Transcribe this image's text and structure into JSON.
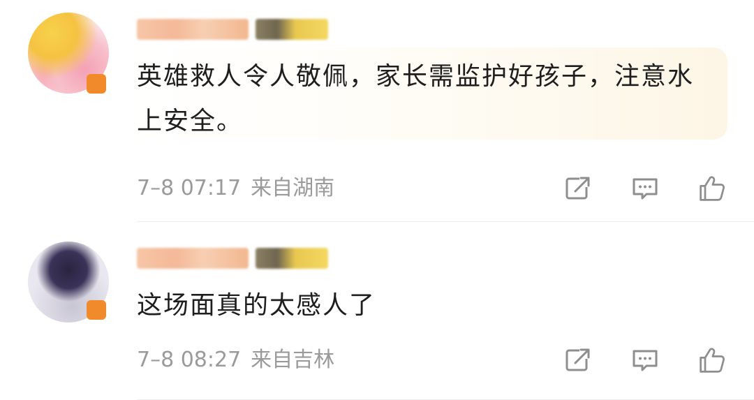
{
  "comments": [
    {
      "text": "英雄救人令人敬佩，家长需监护好孩子，注意水上安全。",
      "date": "7–8 07:17",
      "location": "来自湖南",
      "actions": {
        "share_icon": "share-icon",
        "comment_icon": "comment-icon",
        "like_icon": "like-icon"
      }
    },
    {
      "text": "这场面真的太感人了",
      "date": "7–8 08:27",
      "location": "来自吉林",
      "actions": {
        "share_icon": "share-icon",
        "comment_icon": "comment-icon",
        "like_icon": "like-icon"
      }
    }
  ],
  "colors": {
    "text": "#1e1e1e",
    "meta": "#9a9a9a",
    "icon": "#8e8e8e",
    "divider": "#ececec"
  }
}
